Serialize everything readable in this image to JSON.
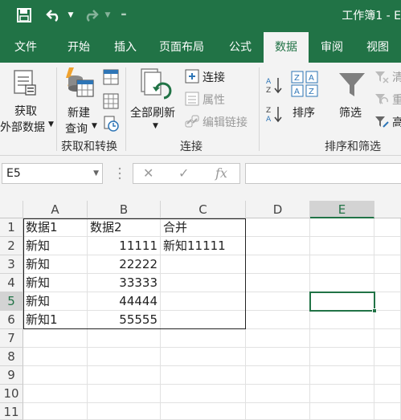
{
  "window": {
    "title": "工作簿1 - E"
  },
  "quick_access": {
    "save_icon": "save-icon",
    "undo_icon": "undo-icon",
    "redo_icon": "redo-icon",
    "customize_icon": "customize-icon"
  },
  "tabs": [
    "文件",
    "开始",
    "插入",
    "页面布局",
    "公式",
    "数据",
    "审阅",
    "视图"
  ],
  "active_tab": "数据",
  "ribbon": {
    "get_external_line1": "获取",
    "get_external_line2": "外部数据",
    "new_query_line1": "新建",
    "new_query_line2": "查询",
    "group_get_transform": "获取和转换",
    "refresh_all": "全部刷新",
    "connections": "连接",
    "properties": "属性",
    "edit_links": "编辑链接",
    "group_connections": "连接",
    "sort": "排序",
    "filter": "筛选",
    "clear": "清",
    "reapply": "重",
    "advanced": "高",
    "group_sort_filter": "排序和筛选"
  },
  "formula_bar": {
    "name_box": "E5",
    "fx_label": "fx",
    "formula": ""
  },
  "grid": {
    "columns": [
      "A",
      "B",
      "C",
      "D",
      "E"
    ],
    "selected_column": "E",
    "rows": [
      "1",
      "2",
      "3",
      "4",
      "5",
      "6",
      "7",
      "8",
      "9",
      "10",
      "11"
    ],
    "selected_row": "5",
    "cells": [
      [
        "数据1",
        "数据2",
        "合并"
      ],
      [
        "新知",
        "11111",
        "新知11111"
      ],
      [
        "新知",
        "22222",
        ""
      ],
      [
        "新知",
        "33333",
        ""
      ],
      [
        "新知",
        "44444",
        ""
      ],
      [
        "新知1",
        "55555",
        ""
      ]
    ]
  },
  "colors": {
    "accent": "#217346",
    "ribbon_bg": "#f3f3f3",
    "header_bg": "#f3f3f3"
  }
}
